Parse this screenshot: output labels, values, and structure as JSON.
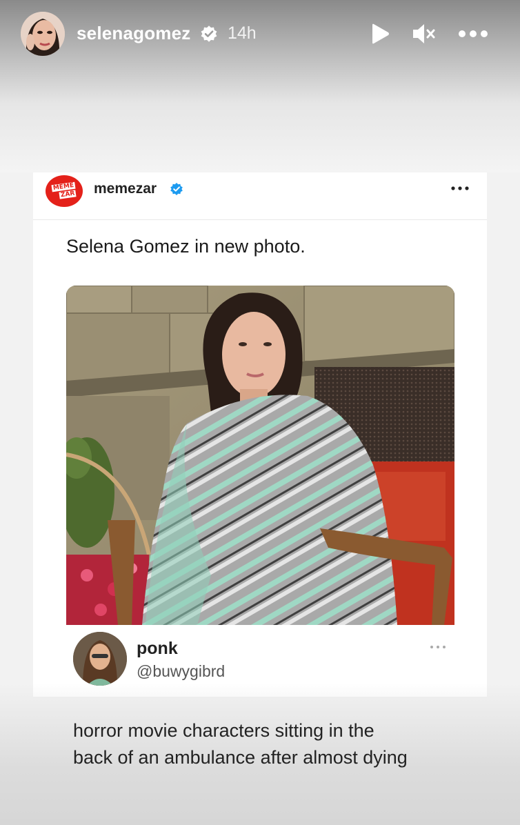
{
  "header": {
    "username": "selenagomez",
    "time": "14h",
    "icons": {
      "verified": "verified-badge-icon",
      "play": "play-icon",
      "mute": "speaker-muted-icon",
      "more": "more-options-icon"
    }
  },
  "tweet": {
    "author": "memezar",
    "logo_text_top": "MEME",
    "logo_text_bottom": "ZAR",
    "caption": "Selena Gomez in new photo.",
    "accent_color": "#e4211a",
    "verified_color": "#1d9bf0"
  },
  "reply": {
    "name": "ponk",
    "handle": "@buwygibrd",
    "text_line1": "horror movie characters sitting in the",
    "text_line2": "back of an ambulance after almost dying"
  }
}
